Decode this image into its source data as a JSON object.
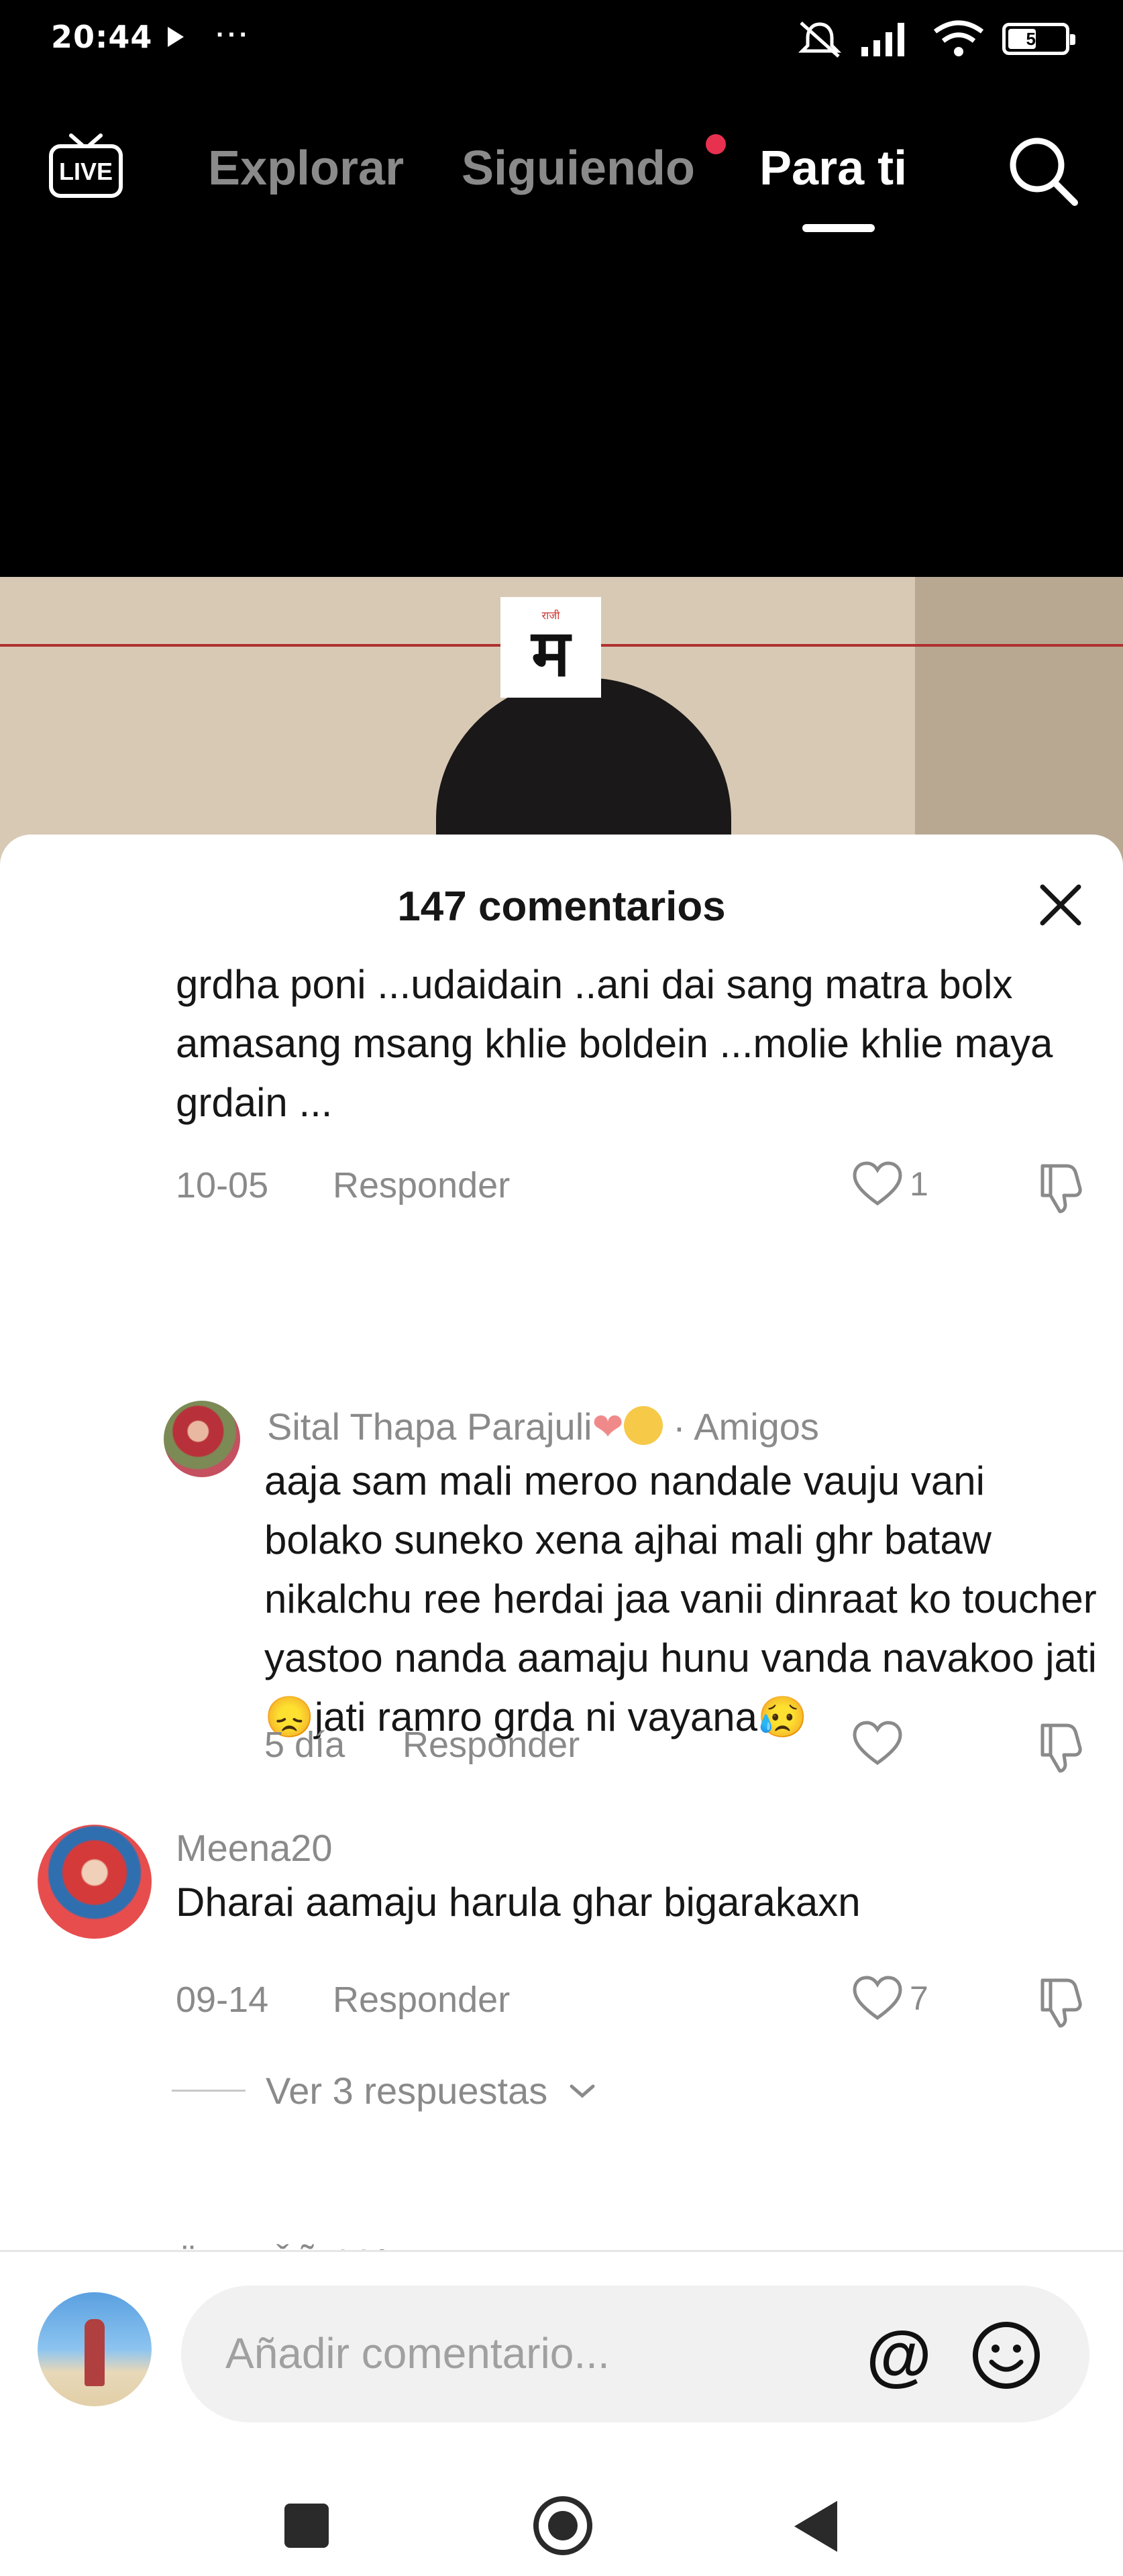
{
  "status_bar": {
    "time": "20:44",
    "more": "···",
    "battery_level": "52",
    "icons": [
      "play-icon",
      "mute-icon",
      "signal-icon",
      "wifi-icon",
      "battery-icon"
    ]
  },
  "top_nav": {
    "live_label": "LIVE",
    "tabs": [
      {
        "label": "Explorar",
        "active": false
      },
      {
        "label": "Siguiendo",
        "active": false,
        "has_notification_dot": true
      },
      {
        "label": "Para ti",
        "active": true
      }
    ]
  },
  "video": {
    "logo_small": "राजी",
    "logo_text": "म"
  },
  "comments_sheet": {
    "title": "147 comentarios",
    "comments": [
      {
        "text": "grdha poni ...udaidain ..ani dai sang matra bolx amasang msang khlie boldein ...molie khlie maya grdain ...",
        "date": "10-05",
        "reply_label": "Responder",
        "likes": "1"
      },
      {
        "author": "Sital Thapa Parajuli",
        "author_tag": "· Amigos",
        "text_part1": "aaja sam mali meroo nandale vauju vani bolako suneko xena ajhai mali ghr bataw nikalchu ree herdai jaa vanii dinraat ko toucher yastoo nanda aamaju hunu vanda navakoo jati",
        "text_part2": "jati ramro grda ni vayana",
        "emoji_1": "😞",
        "emoji_2": "😥",
        "date": "5 día",
        "reply_label": "Responder",
        "likes": ""
      },
      {
        "author": "Meena20",
        "text": "Dharai aamaju harula ghar bigarakaxn",
        "date": "09-14",
        "reply_label": "Responder",
        "likes": "7",
        "view_replies": "Ver 3 respuestas"
      },
      {
        "author": "ŸWF ŠÃçhįń"
      }
    ]
  },
  "input_bar": {
    "placeholder": "Añadir comentario...",
    "mention_symbol": "@"
  },
  "colors": {
    "accent_red": "#e8304f",
    "muted_text": "#8a8a8a",
    "body_text": "#161616"
  }
}
